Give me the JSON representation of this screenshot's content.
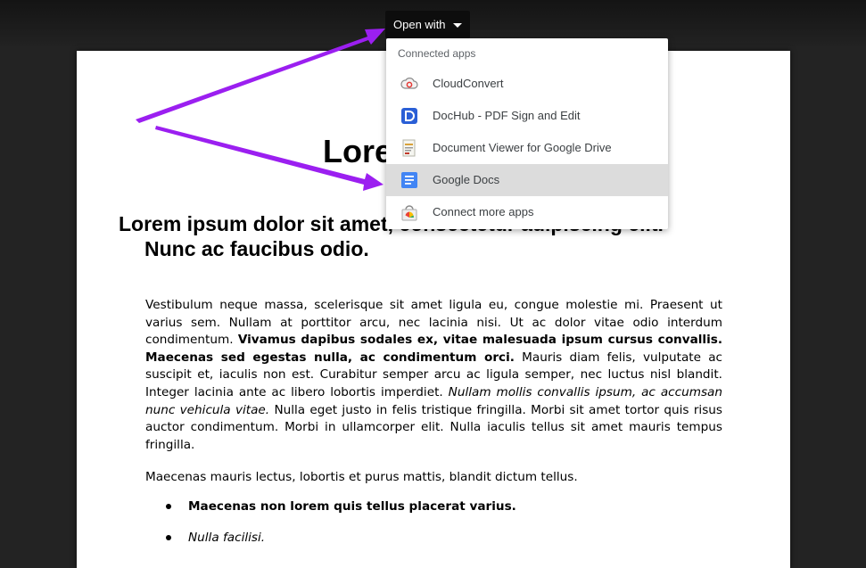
{
  "toolbar": {
    "open_with_label": "Open with",
    "caret_icon": "caret-down-icon"
  },
  "menu": {
    "header": "Connected apps",
    "items": [
      {
        "label": "CloudConvert",
        "icon": "cloudconvert-icon"
      },
      {
        "label": "DocHub - PDF Sign and Edit",
        "icon": "dochub-icon"
      },
      {
        "label": "Document Viewer for Google Drive",
        "icon": "document-viewer-icon"
      },
      {
        "label": "Google Docs",
        "icon": "google-docs-icon",
        "selected": true
      },
      {
        "label": "Connect more apps",
        "icon": "connect-more-apps-icon"
      }
    ]
  },
  "document": {
    "title": "Lorem",
    "heading_line1": "Lorem ipsum dolor sit amet, consectetur adipiscing elit.",
    "heading_line2": "Nunc ac faucibus odio.",
    "para1": {
      "s1": "Vestibulum neque massa, scelerisque sit amet ligula eu, congue molestie mi. Praesent ut varius sem. Nullam at porttitor arcu, nec lacinia nisi. Ut ac dolor vitae odio interdum condimentum. ",
      "s2_bold": "Vivamus dapibus sodales ex, vitae malesuada ipsum cursus convallis. Maecenas sed egestas nulla, ac condimentum orci.",
      "s3": " Mauris diam felis, vulputate ac suscipit et, iaculis non est. Curabitur semper arcu ac ligula semper, nec luctus nisl blandit. Integer lacinia ante ac libero lobortis imperdiet. ",
      "s4_italic": "Nullam mollis convallis ipsum, ac accumsan nunc vehicula vitae.",
      "s5": " Nulla eget justo in felis tristique fringilla. Morbi sit amet tortor quis risus auctor condimentum. Morbi in ullamcorper elit. Nulla iaculis tellus sit amet mauris tempus fringilla."
    },
    "para2": "Maecenas mauris lectus, lobortis et purus mattis, blandit dictum tellus.",
    "bullets": [
      "Maecenas non lorem quis tellus placerat varius.",
      "Nulla facilisi."
    ]
  },
  "colors": {
    "annotation_arrow": "#9b1ff0",
    "selected_row": "#dcdcdc"
  }
}
